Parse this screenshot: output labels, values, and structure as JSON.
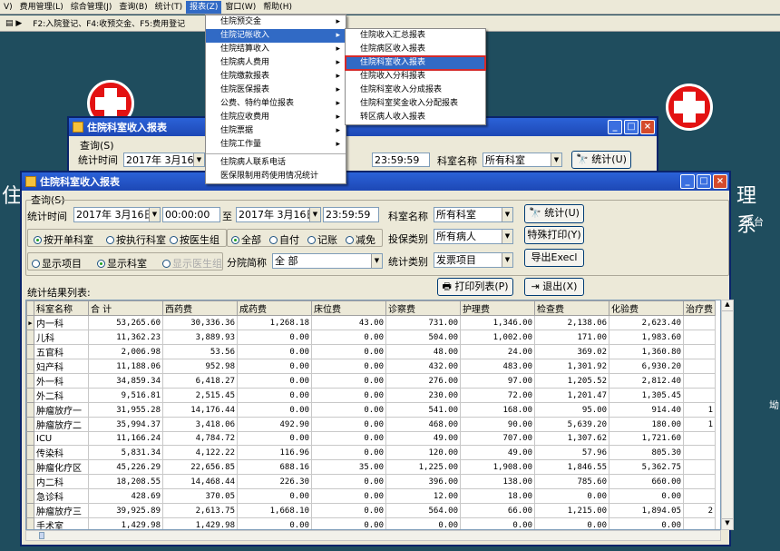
{
  "menubar": [
    "V)",
    "费用管理(L)",
    "综合管理(J)",
    "查询(B)",
    "统计(T)",
    "报表(Z)",
    "窗口(W)",
    "帮助(H)"
  ],
  "toolbar_hint": "F2:入院登记、F4:收预交金、F5:费用登记",
  "background_text": {
    "left": "住",
    "right": "理 系",
    "platform": "平台",
    "side": "坳"
  },
  "menu_report": {
    "items": [
      "住院预交金",
      "住院记帐收入",
      "住院结算收入",
      "住院病人费用",
      "住院缴款报表",
      "住院医保报表",
      "公费、特约单位报表",
      "住院应收费用",
      "住院票据",
      "住院工作量",
      "住院病人联系电话",
      "医保限制用药使用情况统计"
    ]
  },
  "submenu": {
    "items": [
      "住院收入汇总报表",
      "住院病区收入报表",
      "住院科室收入报表",
      "住院收入分科报表",
      "住院科室收入分成报表",
      "住院科室奖金收入分配报表",
      "转区病人收入报表"
    ]
  },
  "back_window": {
    "title": "住院科室收入报表",
    "query_tab": "查询(S)",
    "time_label": "统计时间",
    "start_date": "2017年 3月16日",
    "end_time": "23:59:59",
    "dept_label": "科室名称",
    "dept_value": "所有科室",
    "stat_button": "统计(U)"
  },
  "front_window": {
    "title": "住院科室收入报表",
    "query_tab": "查询(S)",
    "time_label": "统计时间",
    "start_date": "2017年 3月16日",
    "start_time": "00:00:00",
    "to": "至",
    "end_date": "2017年 3月16日",
    "end_time": "23:59:59",
    "dept_label": "科室名称",
    "dept_value": "所有科室",
    "insure_label": "投保类别",
    "insure_value": "所有病人",
    "stat_type_label": "统计类别",
    "stat_type_value": "发票项目",
    "group_label": "分院简称",
    "group_value": "全 部",
    "radios1": [
      "按开单科室",
      "按执行科室",
      "按医生组"
    ],
    "radios2": [
      "全部",
      "自付",
      "记账",
      "减免"
    ],
    "radios3": [
      "显示项目",
      "显示科室",
      "显示医生组"
    ],
    "buttons": {
      "stat": "统计(U)",
      "special_print": "特殊打印(Y)",
      "export": "导出Execl",
      "print_list": "打印列表(P)",
      "exit": "退出(X)"
    },
    "result_label": "统计结果列表:",
    "columns": [
      "科室名称",
      "合 计",
      "西药费",
      "成药费",
      "床位费",
      "诊察费",
      "护理费",
      "检查费",
      "化验费",
      "治疗费"
    ],
    "rows": [
      [
        "内一科",
        "53,265.60",
        "30,336.36",
        "1,268.18",
        "43.00",
        "731.00",
        "1,346.00",
        "2,138.06",
        "2,623.40",
        ""
      ],
      [
        "儿科",
        "11,362.23",
        "3,889.93",
        "0.00",
        "0.00",
        "504.00",
        "1,002.00",
        "171.00",
        "1,983.60",
        ""
      ],
      [
        "五官科",
        "2,006.98",
        "53.56",
        "0.00",
        "0.00",
        "48.00",
        "24.00",
        "369.02",
        "1,360.80",
        ""
      ],
      [
        "妇产科",
        "11,188.06",
        "952.98",
        "0.00",
        "0.00",
        "432.00",
        "483.00",
        "1,301.92",
        "6,930.20",
        ""
      ],
      [
        "外一科",
        "34,859.34",
        "6,418.27",
        "0.00",
        "0.00",
        "276.00",
        "97.00",
        "1,205.52",
        "2,812.40",
        ""
      ],
      [
        "外二科",
        "9,516.81",
        "2,515.45",
        "0.00",
        "0.00",
        "230.00",
        "72.00",
        "1,201.47",
        "1,305.45",
        ""
      ],
      [
        "肿瘤放疗一",
        "31,955.28",
        "14,176.44",
        "0.00",
        "0.00",
        "541.00",
        "168.00",
        "95.00",
        "914.40",
        "1"
      ],
      [
        "肿瘤放疗二",
        "35,994.37",
        "3,418.06",
        "492.90",
        "0.00",
        "468.00",
        "90.00",
        "5,639.20",
        "180.00",
        "1"
      ],
      [
        "ICU",
        "11,166.24",
        "4,784.72",
        "0.00",
        "0.00",
        "49.00",
        "707.00",
        "1,307.62",
        "1,721.60",
        ""
      ],
      [
        "传染科",
        "5,831.34",
        "4,122.22",
        "116.96",
        "0.00",
        "120.00",
        "49.00",
        "57.96",
        "805.30",
        ""
      ],
      [
        "肿瘤化疗区",
        "45,226.29",
        "22,656.85",
        "688.16",
        "35.00",
        "1,225.00",
        "1,908.00",
        "1,846.55",
        "5,362.75",
        ""
      ],
      [
        "内二科",
        "18,208.55",
        "14,468.44",
        "226.30",
        "0.00",
        "396.00",
        "138.00",
        "785.60",
        "660.00",
        ""
      ],
      [
        "急诊科",
        "428.69",
        "370.05",
        "0.00",
        "0.00",
        "12.00",
        "18.00",
        "0.00",
        "0.00",
        ""
      ],
      [
        "肿瘤放疗三",
        "39,925.89",
        "2,613.75",
        "1,668.10",
        "0.00",
        "564.00",
        "66.00",
        "1,215.00",
        "1,894.05",
        "2"
      ],
      [
        "手术室",
        "1,429.98",
        "1,429.98",
        "0.00",
        "0.00",
        "0.00",
        "0.00",
        "0.00",
        "0.00",
        ""
      ]
    ]
  }
}
